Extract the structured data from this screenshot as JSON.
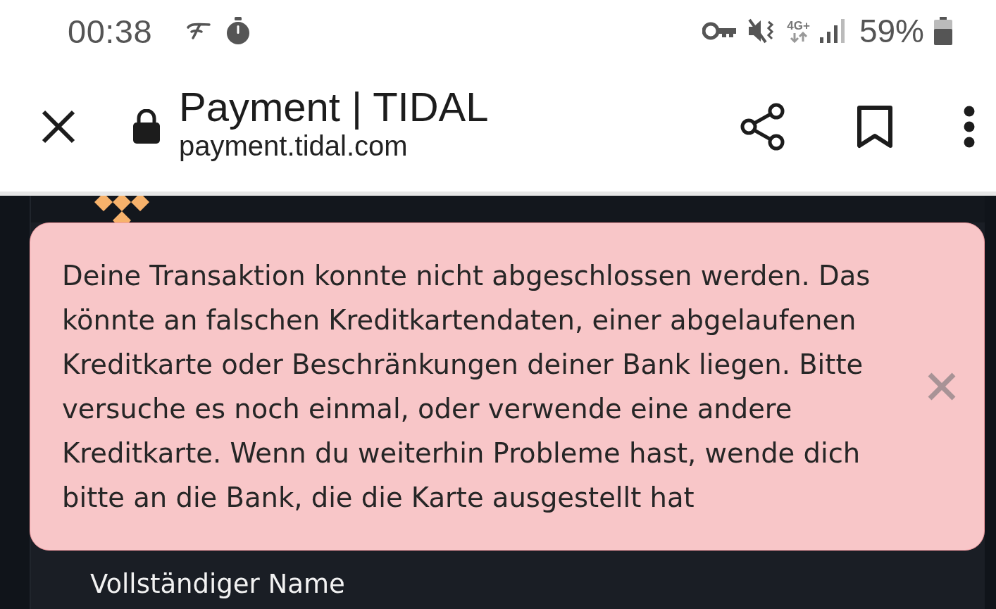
{
  "status_bar": {
    "time": "00:38",
    "network": "4G+",
    "battery": "59%"
  },
  "browser_toolbar": {
    "title": "Payment | TIDAL",
    "url": "payment.tidal.com"
  },
  "alert": {
    "message": "Deine Transaktion konnte nicht abgeschlossen werden. Das könnte an falschen Kreditkartendaten, einer abgelaufenen Kreditkarte oder Beschränkungen deiner Bank liegen. Bitte versuche es noch einmal, oder verwende eine andere Kreditkarte. Wenn du weiterhin Probleme hast, wende dich bitte an die Bank, die die Karte ausgestellt hat"
  },
  "form": {
    "fields": [
      {
        "label": "Vollständiger Name"
      }
    ]
  }
}
